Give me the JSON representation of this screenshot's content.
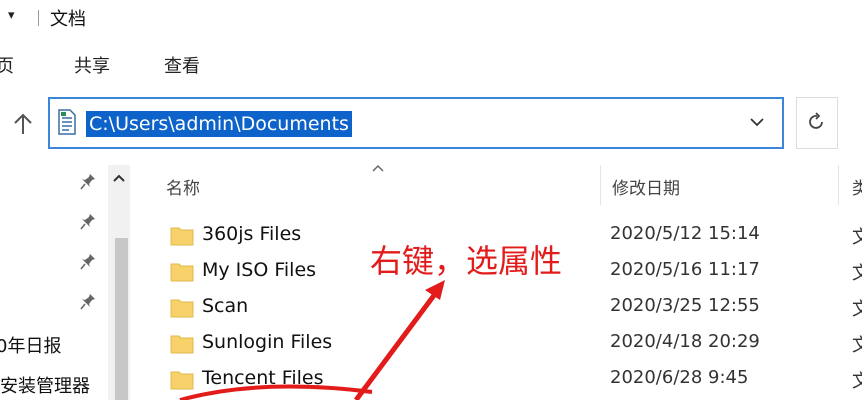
{
  "window": {
    "title": "文档",
    "quick_access_arrow": "▾"
  },
  "ribbon": {
    "tabs": [
      "页",
      "共享",
      "查看"
    ]
  },
  "address": {
    "path": "C:\\Users\\admin\\Documents"
  },
  "nav": {
    "labels": [
      "0年日报",
      "安装管理器"
    ]
  },
  "columns": {
    "name": "名称",
    "date": "修改日期",
    "third": "类"
  },
  "files": [
    {
      "name": "360js Files",
      "date": "2020/5/12 15:14",
      "type": "文"
    },
    {
      "name": "My ISO Files",
      "date": "2020/5/16 11:17",
      "type": "文"
    },
    {
      "name": "Scan",
      "date": "2020/3/25 12:55",
      "type": "文"
    },
    {
      "name": "Sunlogin Files",
      "date": "2020/4/18 20:29",
      "type": "文"
    },
    {
      "name": "Tencent Files",
      "date": "2020/6/28 9:45",
      "type": "文"
    }
  ],
  "annotation": {
    "text": "右键，选属性",
    "color": "#e21b1b"
  },
  "colors": {
    "selection": "#0d63c9",
    "focus_border": "#3c86d8",
    "folder": "#f7d26b"
  },
  "icons": [
    "chevron-down-icon",
    "up-arrow-icon",
    "document-icon",
    "refresh-icon",
    "pin-icon",
    "folder-icon",
    "sort-caret-icon",
    "scroll-up-icon"
  ]
}
